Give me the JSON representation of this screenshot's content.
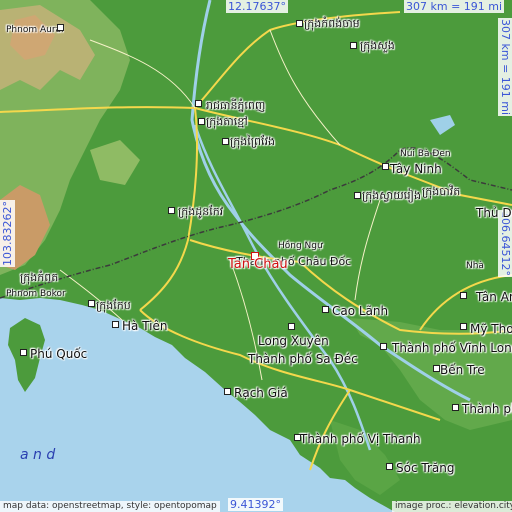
{
  "coords": {
    "top_lon": "12.17637°",
    "bottom_lon": "9.41392°",
    "left_lat": "103.83262°",
    "right_lat": "106.64512°",
    "scale_top": "307 km = 191 mi",
    "scale_right": "307 km = 191 mi"
  },
  "credits": {
    "left": "map data: openstreetmap, style: opentopomap",
    "right": "image proc.: elevation.city"
  },
  "focus": {
    "name": "Tan Chau"
  },
  "places": {
    "phnom_aural": "Phnom Aural",
    "phnom_penh": "រាជធានីភ្នំពេញ",
    "ta_khmau": "ក្រុងតាខ្មៅ",
    "kampong_cham": "ក្រុងកំពង់ចាម",
    "suong": "ក្រុងសួង",
    "prey_veng": "ក្រុងព្រៃវែង",
    "takeo": "ក្រុងដូនកែវ",
    "svay_rieng": "ក្រុងស្វាយរៀង",
    "kampot": "ក្រុងកំពត",
    "kep": "ក្រុងកែប",
    "phnom_bokor": "Phnom Bokor",
    "nui_ba_den": "Núi Bà Đen",
    "tay_ninh": "Tây Ninh",
    "bavet": "ក្រុងបាវិត",
    "thu_dau_mot": "Thủ Dầ",
    "hong_ngu": "Hồng Ngự",
    "chau_doc": "Thành phố Châu Đốc",
    "tan_an": "Tân An",
    "cao_lanh": "Cao Lãnh",
    "ha_tien": "Hà Tiên",
    "long_xuyen": "Long Xuyên",
    "sa_dec": "Thành phố Sa Đéc",
    "my_tho": "Mỹ Tho",
    "vinh_long": "Thành phố Vĩnh Long",
    "ben_tre": "Bến Tre",
    "phu_quoc": "Phú Quốc",
    "rach_gia": "Rạch Giá",
    "thanh_pho": "Thành phố",
    "vi_thanh": "Thành phố Vị Thanh",
    "soc_trang": "Sóc Trăng",
    "nha": "Nhà",
    "sea_letters": "a   n   d"
  },
  "colors": {
    "land": "#4c9b3c",
    "land_light": "#79b55d",
    "sea": "#a9d3ec",
    "road_major": "#f4d84c",
    "road_minor": "#f6f2c8",
    "border": "#3b3b3b",
    "focus": "#d01010",
    "coord_text": "#3b56d6"
  }
}
